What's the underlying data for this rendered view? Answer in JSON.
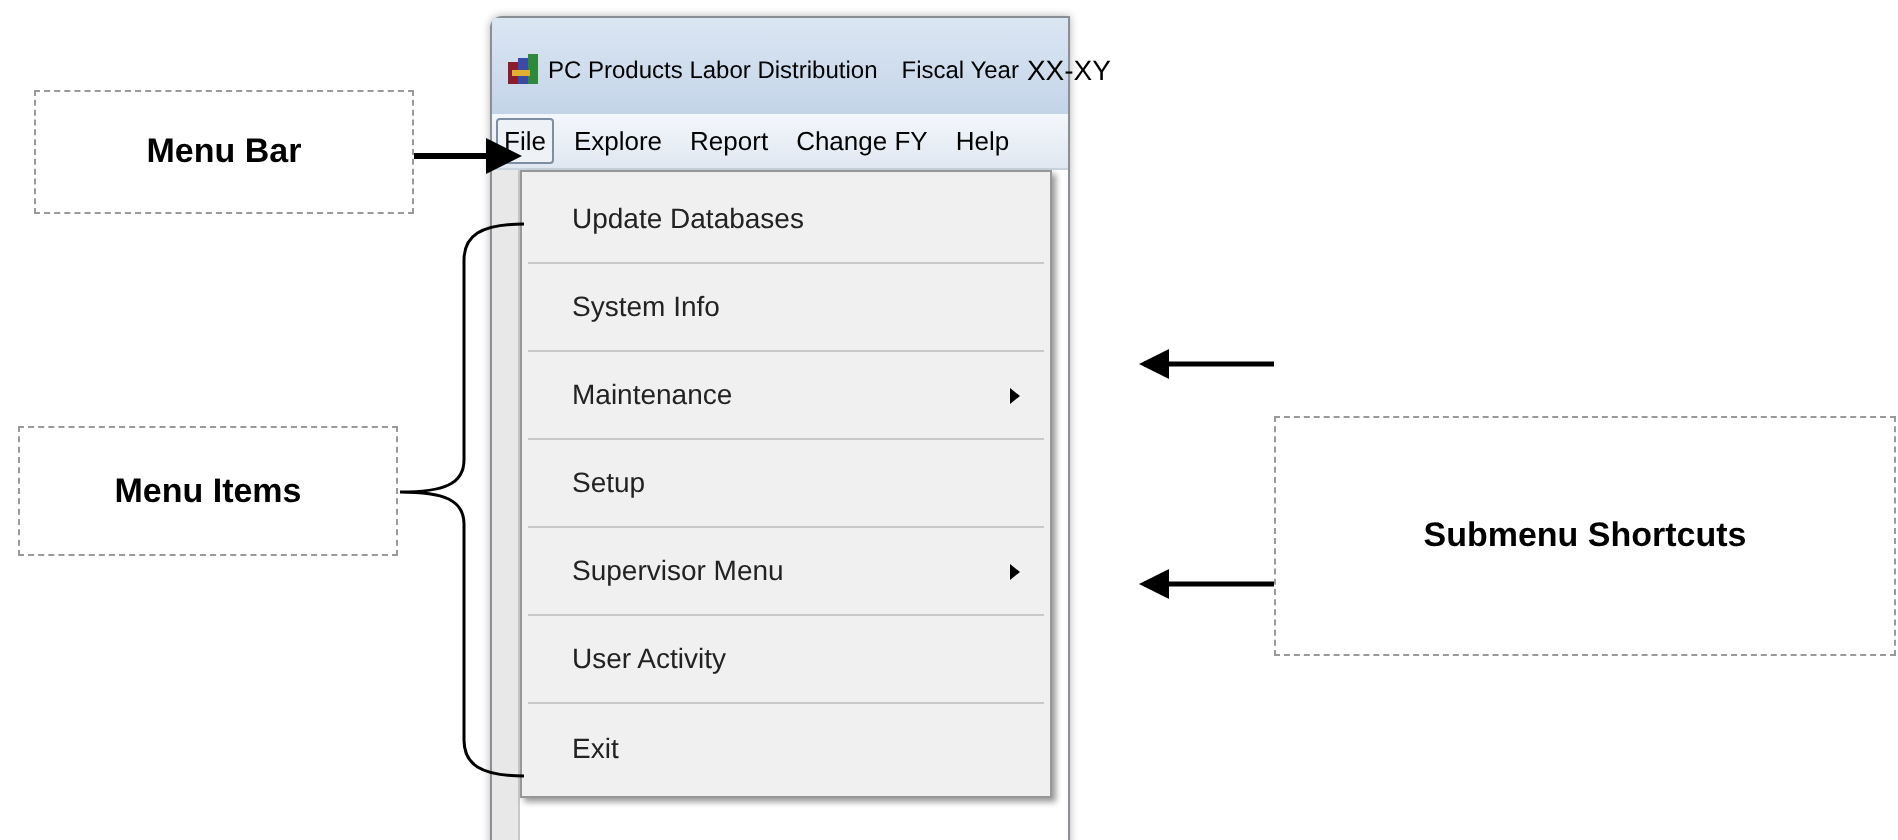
{
  "window": {
    "title": "PC Products  Labor Distribution",
    "fiscal_label": "Fiscal Year",
    "fiscal_year": "XX-XY"
  },
  "menu_bar": [
    {
      "label": "File",
      "selected": true
    },
    {
      "label": "Explore",
      "selected": false
    },
    {
      "label": "Report",
      "selected": false
    },
    {
      "label": "Change FY",
      "selected": false
    },
    {
      "label": "Help",
      "selected": false
    }
  ],
  "menu_items": [
    {
      "label": "Update Databases",
      "submenu": false
    },
    {
      "label": "System Info",
      "submenu": false
    },
    {
      "label": "Maintenance",
      "submenu": true
    },
    {
      "label": "Setup",
      "submenu": false
    },
    {
      "label": "Supervisor Menu",
      "submenu": true
    },
    {
      "label": "User Activity",
      "submenu": false
    },
    {
      "label": "Exit",
      "submenu": false
    }
  ],
  "callouts": [
    {
      "label": "Menu Bar"
    },
    {
      "label": "Menu Items"
    },
    {
      "label": "Submenu Shortcuts"
    }
  ]
}
